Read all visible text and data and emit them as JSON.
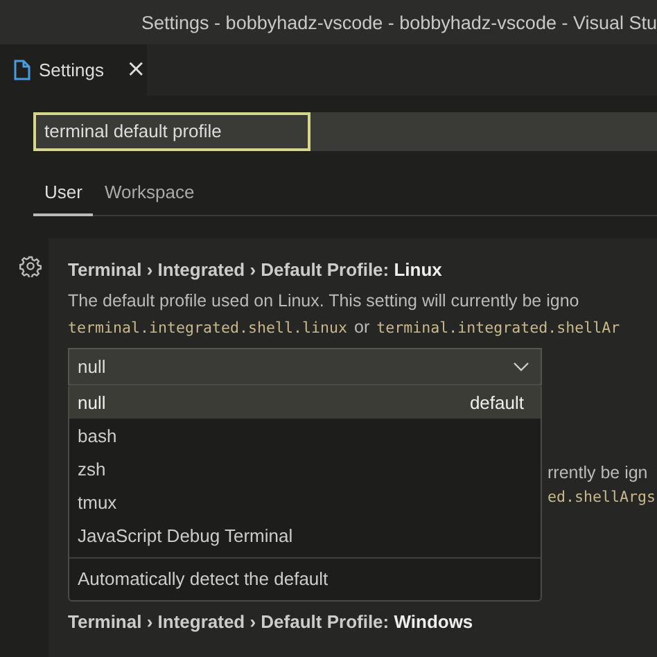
{
  "window": {
    "title": "Settings - bobbyhadz-vscode - bobbyhadz-vscode - Visual Stu"
  },
  "editor_tab": {
    "label": "Settings",
    "close": "×"
  },
  "search": {
    "value": "terminal default profile"
  },
  "scope_tabs": [
    {
      "label": "User",
      "selected": true
    },
    {
      "label": "Workspace",
      "selected": false
    }
  ],
  "setting": {
    "category": "Terminal › Integrated › Default Profile: ",
    "name": "Linux",
    "description": "The default profile used on Linux. This setting will currently be igno",
    "code_1": "terminal.integrated.shell.linux",
    "connector": "or",
    "code_2": "terminal.integrated.shellAr",
    "select": {
      "value": "null",
      "options": [
        {
          "label": "null",
          "detail": "default",
          "selected": true,
          "kind": "option"
        },
        {
          "label": "bash",
          "selected": false,
          "kind": "option"
        },
        {
          "label": "zsh",
          "selected": false,
          "kind": "option"
        },
        {
          "label": "tmux",
          "selected": false,
          "kind": "option"
        },
        {
          "label": "JavaScript Debug Terminal",
          "selected": false,
          "kind": "option"
        },
        {
          "label": "Automatically detect the default",
          "selected": false,
          "kind": "action"
        }
      ]
    }
  },
  "covered_setting": {
    "description": "rrently be ign",
    "code": "ed.shellArgs"
  },
  "next_setting": {
    "category": "Terminal › Integrated › Default Profile: ",
    "name": "Windows"
  }
}
